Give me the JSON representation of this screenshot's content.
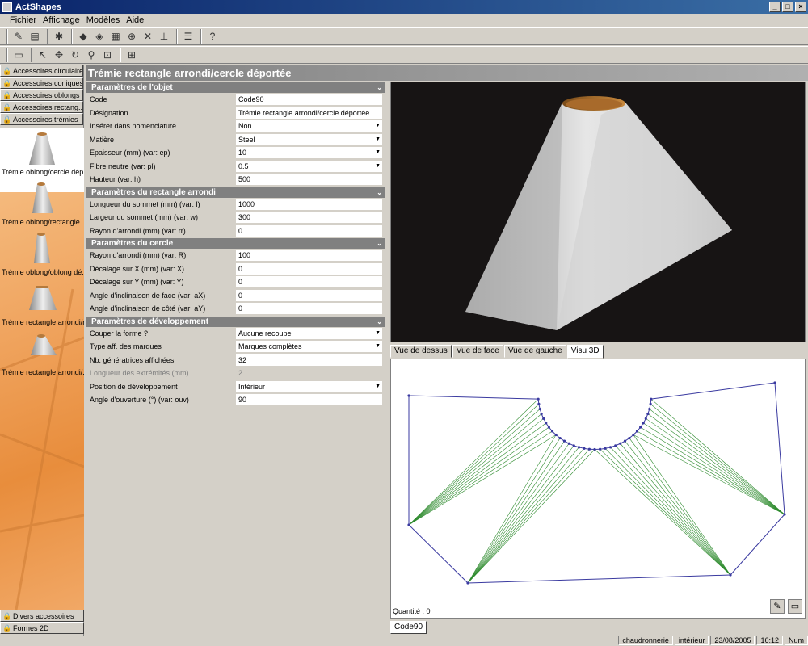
{
  "window": {
    "title": "ActShapes"
  },
  "menu": [
    "Fichier",
    "Affichage",
    "Modèles",
    "Aide"
  ],
  "panel_title": "Trémie rectangle arrondi/cercle déportée",
  "left": {
    "categories": [
      "Accessoires circulaires",
      "Accessoires coniques",
      "Accessoires oblongs",
      "Accessoires rectang...",
      "Accessoires trémies"
    ],
    "shapes": [
      "Trémie oblong/cercle dép...",
      "Trémie oblong/rectangle ...",
      "Trémie oblong/oblong dé...",
      "Trémie rectangle arrondi/r...",
      "Trémie rectangle arrondi/..."
    ],
    "bottom": [
      "Divers accessoires",
      "Formes 2D"
    ]
  },
  "sections": [
    {
      "title": "Paramètres de l'objet",
      "rows": [
        {
          "label": "Code",
          "value": "Code90",
          "dd": false
        },
        {
          "label": "Désignation",
          "value": "Trémie rectangle arrondi/cercle déportée",
          "dd": false
        },
        {
          "label": "Insérer dans nomenclature",
          "value": "Non",
          "dd": true
        },
        {
          "label": "Matière",
          "value": "Steel",
          "dd": true
        },
        {
          "label": "Epaisseur (mm) (var: ep)",
          "value": "10",
          "dd": true
        },
        {
          "label": "Fibre neutre (var: pl)",
          "value": "0.5",
          "dd": true
        },
        {
          "label": "Hauteur (var: h)",
          "value": "500",
          "dd": false
        }
      ]
    },
    {
      "title": "Paramètres du rectangle arrondi",
      "rows": [
        {
          "label": "Longueur du sommet (mm) (var: l)",
          "value": "1000",
          "dd": false
        },
        {
          "label": "Largeur du sommet (mm) (var: w)",
          "value": "300",
          "dd": false
        },
        {
          "label": "Rayon d'arrondi (mm) (var: rr)",
          "value": "0",
          "dd": false
        }
      ]
    },
    {
      "title": "Paramètres du cercle",
      "rows": [
        {
          "label": "Rayon d'arrondi (mm) (var: R)",
          "value": "100",
          "dd": false
        },
        {
          "label": "Décalage sur X (mm) (var: X)",
          "value": "0",
          "dd": false
        },
        {
          "label": "Décalage sur Y (mm) (var: Y)",
          "value": "0",
          "dd": false
        },
        {
          "label": "Angle d'inclinaison de face (var: aX)",
          "value": "0",
          "dd": false
        },
        {
          "label": "Angle d'inclinaison de côté (var: aY)",
          "value": "0",
          "dd": false
        }
      ]
    },
    {
      "title": "Paramètres de développement",
      "rows": [
        {
          "label": "Couper la forme ?",
          "value": "Aucune recoupe",
          "dd": true
        },
        {
          "label": "Type aff. des marques",
          "value": "Marques complètes",
          "dd": true
        },
        {
          "label": "Nb. génératrices affichées",
          "value": "32",
          "dd": false
        },
        {
          "label": "Longueur des extrémités (mm)",
          "value": "2",
          "dd": false,
          "disabled": true
        },
        {
          "label": "Position de développement",
          "value": "Intérieur",
          "dd": true
        },
        {
          "label": "Angle d'ouverture (°) (var: ouv)",
          "value": "90",
          "dd": false
        }
      ]
    }
  ],
  "view_tabs": [
    "Vue de dessus",
    "Vue de face",
    "Vue de gauche",
    "Visu 3D"
  ],
  "active_view_tab": "Visu 3D",
  "quantity_label": "Quantité : 0",
  "document_tab": "Code90",
  "status": [
    "chaudronnerie",
    "intérieur",
    "23/08/2005",
    "16:12",
    "Num"
  ],
  "colors": {
    "title_bar": "#0a246a",
    "generatrix": "#2e8b2e",
    "outline": "#3a3aa0",
    "background_3d": "#171414"
  }
}
